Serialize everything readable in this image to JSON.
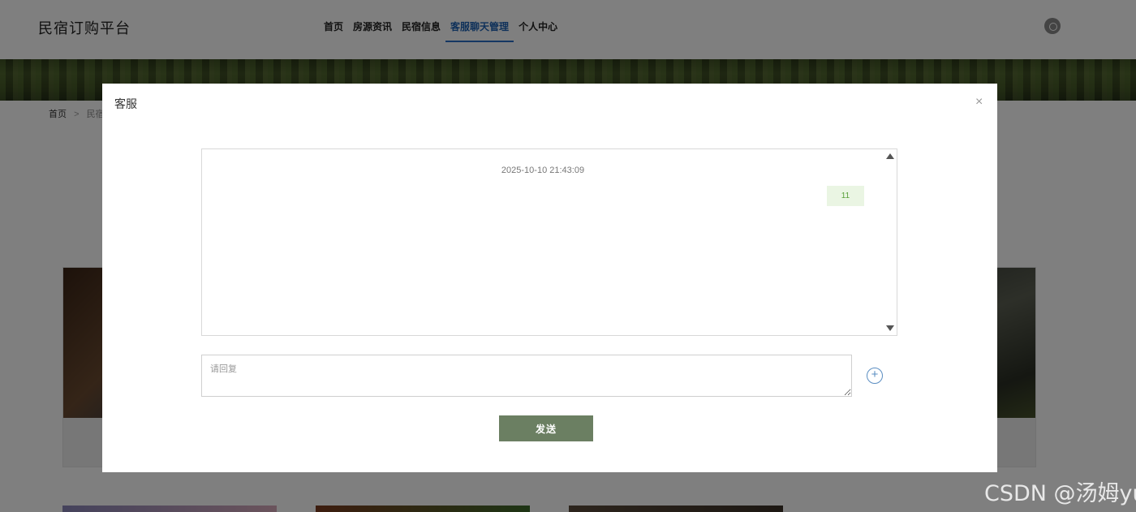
{
  "header": {
    "brand": "民宿订购平台",
    "nav": [
      {
        "label": "首页",
        "active": false
      },
      {
        "label": "房源资讯",
        "active": false
      },
      {
        "label": "民宿信息",
        "active": false
      },
      {
        "label": "客服聊天管理",
        "active": true
      },
      {
        "label": "个人中心",
        "active": false
      }
    ],
    "power_icon": "power-icon"
  },
  "breadcrumb": {
    "home": "首页",
    "separator": ">",
    "current": "民宿"
  },
  "modal": {
    "title": "客服",
    "close_label": "×",
    "chat": {
      "timestamp": "2025-10-10 21:43:09",
      "messages": [
        {
          "text": "11",
          "side": "right"
        }
      ]
    },
    "reply": {
      "placeholder": "请回复",
      "value": ""
    },
    "add_icon": "+",
    "send_label": "发送"
  },
  "watermark": "CSDN @汤姆yu",
  "colors": {
    "accent": "#1f63b5",
    "send_button": "#6b7f62",
    "bubble_bg": "#eaf5e3",
    "bubble_text": "#5aa03a"
  }
}
